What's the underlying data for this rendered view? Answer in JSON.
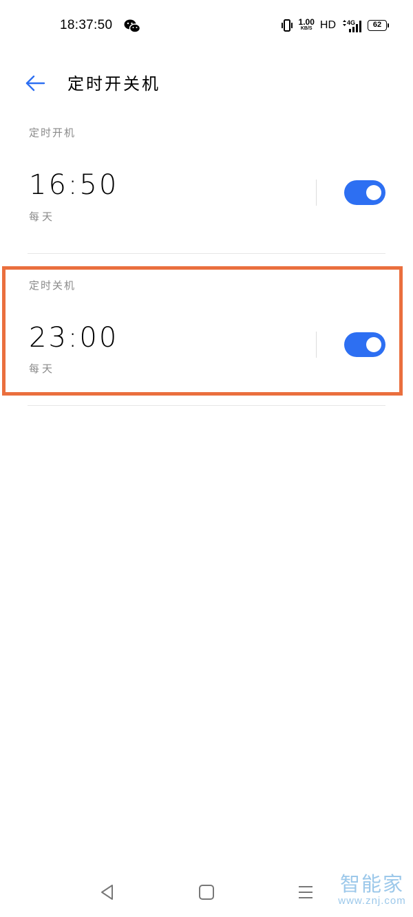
{
  "status_bar": {
    "time": "18:37:50",
    "net_speed_value": "1.00",
    "net_speed_unit": "KB/S",
    "hd": "HD",
    "network": "4G",
    "battery": "62"
  },
  "header": {
    "title": "定时开关机"
  },
  "schedules": [
    {
      "label": "定时开机",
      "time": "16:50",
      "repeat": "每天",
      "enabled": true
    },
    {
      "label": "定时关机",
      "time": "23:00",
      "repeat": "每天",
      "enabled": true
    }
  ],
  "watermark": {
    "main": "智能家",
    "sub": "www.znj.com"
  },
  "colors": {
    "accent": "#2d6ff2",
    "highlight": "#ea6f3e",
    "watermark": "#9cc8ea"
  }
}
